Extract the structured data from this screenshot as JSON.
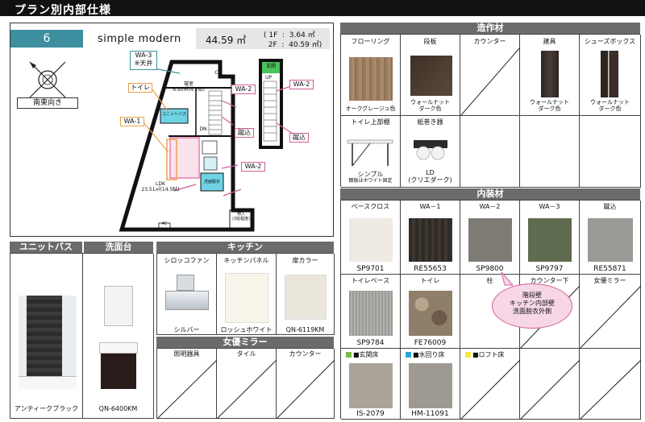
{
  "page_title": "プラン別内部仕様",
  "plan": {
    "number": "6",
    "name": "simple modern",
    "area_total": "44.59 ㎡",
    "area_1f": "( 1F  :  3.64 ㎡",
    "area_2f": "  2F  :  40.59 ㎡)",
    "orientation": "南東向き",
    "labels": {
      "wa3": "WA-3\n※天井",
      "toilet": "トイレ",
      "wa1": "WA-1",
      "wa2a": "WA-2",
      "wa2b": "WA-2",
      "wa2c": "WA-2",
      "sunrise1": "蹴込",
      "sunrise2": "蹴込",
      "bed": "寝室\n6.90㎡(4.2帖)",
      "cl": "CL",
      "ldk": "LDK\n23.51㎡(14.5帖)",
      "wash": "洗面脱衣",
      "unit_bath": "ユニットバス",
      "entry": "玄関",
      "storage": "物入\n(3帖程度)",
      "dn": "DN",
      "up": "UP",
      "ac": "AC"
    }
  },
  "unit_bath": {
    "header": "ユニットバス",
    "caption": "アンティークブラック"
  },
  "washbasin": {
    "header": "洗面台",
    "caption": "QN-6400KM"
  },
  "kitchen": {
    "header": "キッチン",
    "cols": [
      "シロッコファン",
      "キッチンパネル",
      "扉カラー"
    ],
    "values": [
      "シルバー",
      "ロッシュホワイト",
      "QN-6119KM"
    ]
  },
  "actress_mirror_left": {
    "header": "女優ミラー",
    "cols": [
      "照明器具",
      "タイル",
      "カウンター"
    ]
  },
  "built_in": {
    "header": "造作材",
    "cols": [
      "フローリング",
      "段板",
      "カウンター",
      "建具",
      "シューズボックス"
    ],
    "values": [
      "オークグレージュ色",
      "ウォールナット\nダーク色",
      "",
      "ウォールナット\nダーク色",
      "ウォールナット\nダーク色"
    ],
    "row2_cols": [
      "トイレ上部棚",
      "紙巻き器"
    ],
    "row2_values": [
      "シンプル",
      "LD\n(クリエダーク)"
    ],
    "row2_note": "棚板はホワイト固定"
  },
  "interior": {
    "header": "内装材",
    "cols": [
      "ベースクロス",
      "WA－1",
      "WA－2",
      "WA－3",
      "蹴込"
    ],
    "codes": [
      "SP9701",
      "RE55653",
      "SP9800",
      "SP9797",
      "RE55871"
    ],
    "row2_cols": [
      "トイレベース",
      "トイレ",
      "柱",
      "カウンター下",
      "女優ミラー"
    ],
    "row2_codes": [
      "SP9784",
      "FE76009",
      "",
      "",
      ""
    ],
    "legend": [
      "■玄関床",
      "■水回り床",
      "■ロフト床"
    ],
    "legend_colors": [
      "#7dbb4a",
      "#2aa6d6",
      "#f5e73c"
    ],
    "floor_codes": [
      "IS-2079",
      "HM-11091"
    ],
    "balloon": "階段壁\nキッチン内部壁\n洗面脱衣外側"
  },
  "colors": {
    "accent_plan": "#3d8fa0",
    "header_gray": "#6b6b6b",
    "pink": "#d15e99"
  }
}
